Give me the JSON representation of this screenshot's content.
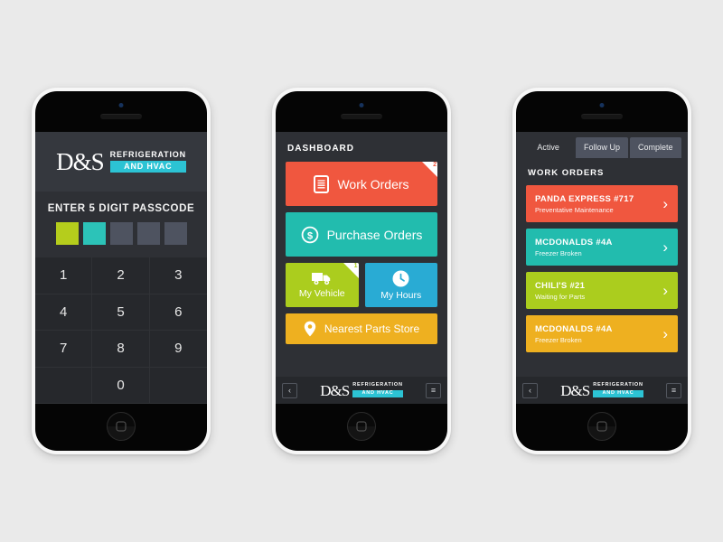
{
  "brand": {
    "mark": "D&S",
    "line1": "REFRIGERATION",
    "line2": "AND HVAC",
    "accent": "#2cc3d4"
  },
  "background": "#eaeaea",
  "phone1": {
    "screen_name": "passcode-lock",
    "prompt": "ENTER 5 DIGIT PASSCODE",
    "passcode_slots": [
      {
        "filled": true,
        "color": "#b5cd1c"
      },
      {
        "filled": true,
        "color": "#2cc3b8"
      },
      {
        "filled": false,
        "color": "#4e5360"
      },
      {
        "filled": false,
        "color": "#4e5360"
      },
      {
        "filled": false,
        "color": "#4e5360"
      }
    ],
    "keys": [
      "1",
      "2",
      "3",
      "4",
      "5",
      "6",
      "7",
      "8",
      "9",
      "",
      "0",
      ""
    ]
  },
  "phone2": {
    "screen_name": "dashboard",
    "title": "DASHBOARD",
    "tiles": [
      {
        "label": "Work Orders",
        "color": "#f0573f",
        "icon": "document-icon",
        "badge": "2",
        "size": "large"
      },
      {
        "label": "Purchase Orders",
        "color": "#22bcae",
        "icon": "dollar-circle-icon",
        "badge": null,
        "size": "large"
      },
      {
        "label": "My Vehicle",
        "color": "#abcd1e",
        "icon": "truck-icon",
        "badge": "1",
        "size": "small"
      },
      {
        "label": "My Hours",
        "color": "#29abd4",
        "icon": "clock-icon",
        "badge": null,
        "size": "small"
      },
      {
        "label": "Nearest Parts Store",
        "color": "#eeb020",
        "icon": "map-pin-icon",
        "badge": null,
        "size": "wide"
      }
    ],
    "nav": {
      "back": "‹",
      "menu": "≡"
    }
  },
  "phone3": {
    "screen_name": "work-orders-list",
    "tabs": [
      {
        "label": "Active",
        "active": true
      },
      {
        "label": "Follow Up",
        "active": false
      },
      {
        "label": "Complete",
        "active": false
      }
    ],
    "title": "WORK ORDERS",
    "orders": [
      {
        "name": "PANDA EXPRESS #717",
        "status": "Preventative Maintenance",
        "color": "#f0573f"
      },
      {
        "name": "MCDONALDS #4A",
        "status": "Freezer Broken",
        "color": "#22bcae"
      },
      {
        "name": "CHILI'S #21",
        "status": "Waiting for Parts",
        "color": "#abcd1e"
      },
      {
        "name": "MCDONALDS #4A",
        "status": "Freezer Broken",
        "color": "#eeb020"
      }
    ],
    "chevron": "›",
    "nav": {
      "back": "‹",
      "menu": "≡"
    }
  }
}
